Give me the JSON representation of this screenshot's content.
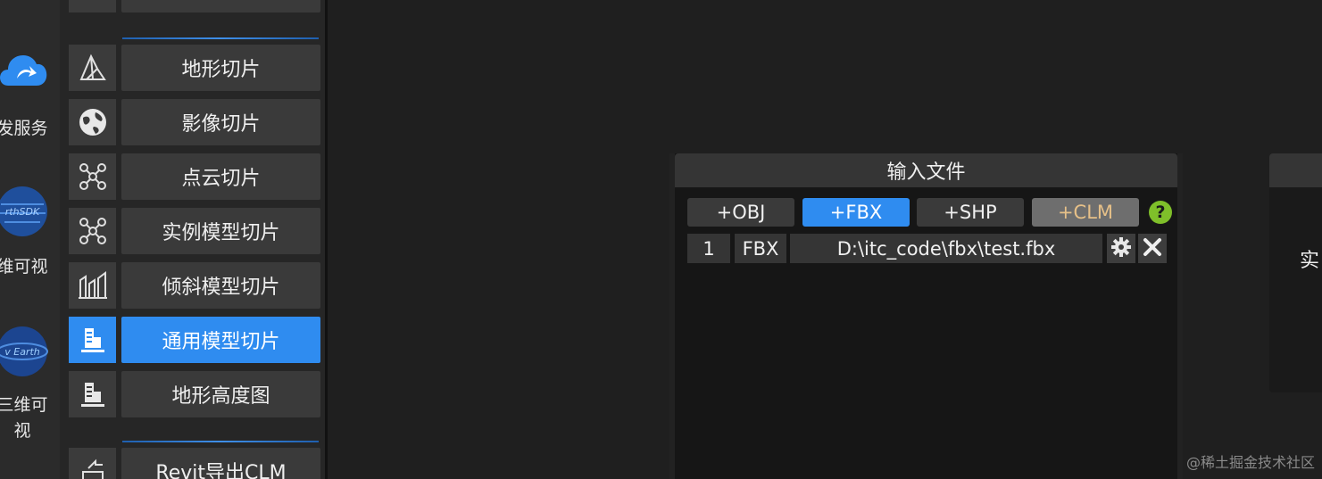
{
  "rail": {
    "items": [
      {
        "label": "发服务",
        "icon": "cloud-upload-icon"
      },
      {
        "label": "维可视",
        "icon": "earth-sdk-icon"
      },
      {
        "label": "三维可",
        "label2": "视",
        "icon": "earth-globe-icon"
      }
    ]
  },
  "tools": {
    "items": [
      {
        "label": "地形切片",
        "icon": "terrain-icon"
      },
      {
        "label": "影像切片",
        "icon": "image-globe-icon"
      },
      {
        "label": "点云切片",
        "icon": "point-cloud-icon"
      },
      {
        "label": "实例模型切片",
        "icon": "instance-model-icon"
      },
      {
        "label": "倾斜模型切片",
        "icon": "oblique-model-icon"
      },
      {
        "label": "通用模型切片",
        "icon": "general-model-icon",
        "active": true
      },
      {
        "label": "地形高度图",
        "icon": "height-map-icon"
      },
      {
        "label": "Revit导出CLM",
        "icon": "revit-export-icon"
      }
    ]
  },
  "panel": {
    "title": "输入文件",
    "buttons": {
      "obj": "+OBJ",
      "fbx": "+FBX",
      "shp": "+SHP",
      "clm": "+CLM"
    },
    "help": "?",
    "file_row": {
      "index": "1",
      "type": "FBX",
      "path": "D:\\itc_code\\fbx\\test.fbx"
    }
  },
  "right_panel": {
    "text": "实"
  },
  "watermark": "@稀土掘金技术社区",
  "colors": {
    "accent": "#2f8cf0",
    "help": "#7fbf2a",
    "clm_text": "#e6c088"
  }
}
